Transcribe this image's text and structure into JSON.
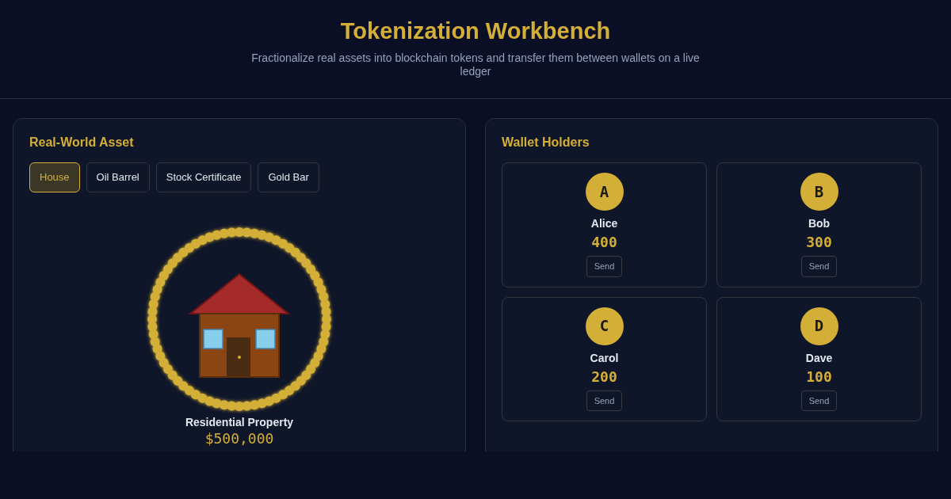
{
  "header": {
    "title": "Tokenization Workbench",
    "subtitle": "Fractionalize real assets into blockchain tokens and transfer them between wallets on a live ledger"
  },
  "asset_panel": {
    "title": "Real-World Asset",
    "asset_tabs": [
      {
        "label": "House",
        "selected": true
      },
      {
        "label": "Oil Barrel",
        "selected": false
      },
      {
        "label": "Stock Certificate",
        "selected": false
      },
      {
        "label": "Gold Bar",
        "selected": false
      }
    ],
    "asset": {
      "kind": "house",
      "name": "Residential Property",
      "value": "$500,000"
    }
  },
  "wallet_panel": {
    "title": "Wallet Holders",
    "wallets": [
      {
        "initial": "A",
        "name": "Alice",
        "balance": "400",
        "button": "Send"
      },
      {
        "initial": "B",
        "name": "Bob",
        "balance": "300",
        "button": "Send"
      },
      {
        "initial": "C",
        "name": "Carol",
        "balance": "200",
        "button": "Send"
      },
      {
        "initial": "D",
        "name": "Dave",
        "balance": "100",
        "button": "Send"
      }
    ]
  }
}
